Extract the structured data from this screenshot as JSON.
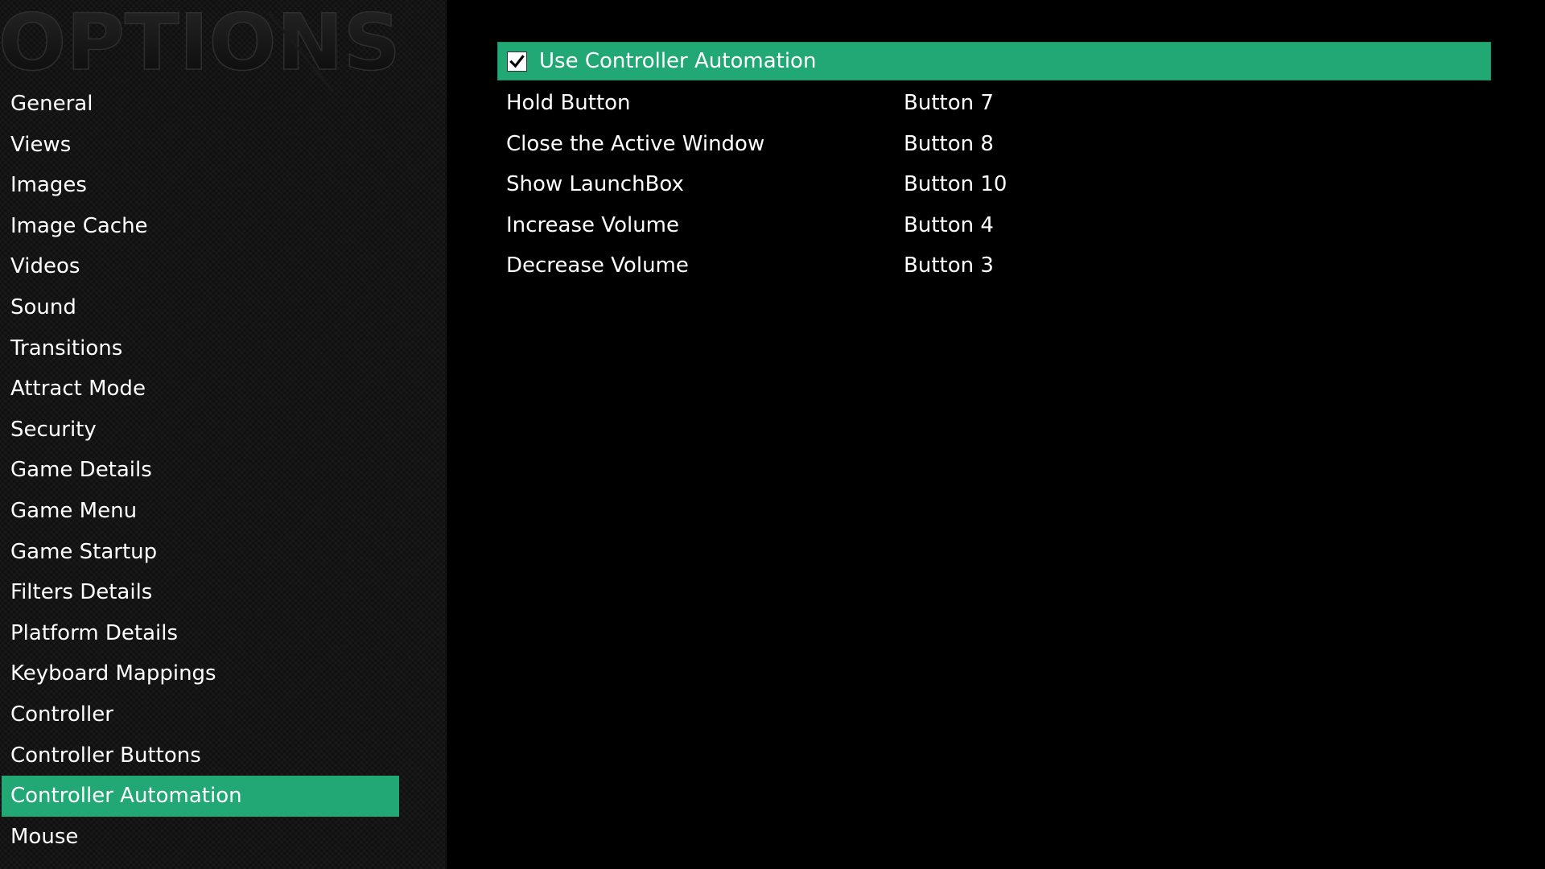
{
  "sidebar": {
    "logo_text": "OPTIONS",
    "items": [
      {
        "label": "General"
      },
      {
        "label": "Views"
      },
      {
        "label": "Images"
      },
      {
        "label": "Image Cache"
      },
      {
        "label": "Videos"
      },
      {
        "label": "Sound"
      },
      {
        "label": "Transitions"
      },
      {
        "label": "Attract Mode"
      },
      {
        "label": "Security"
      },
      {
        "label": "Game Details"
      },
      {
        "label": "Game Menu"
      },
      {
        "label": "Game Startup"
      },
      {
        "label": "Filters Details"
      },
      {
        "label": "Platform Details"
      },
      {
        "label": "Keyboard Mappings"
      },
      {
        "label": "Controller"
      },
      {
        "label": "Controller Buttons"
      },
      {
        "label": "Controller Automation",
        "active": true
      },
      {
        "label": "Mouse"
      }
    ]
  },
  "main": {
    "automation_toggle": {
      "label": "Use Controller Automation",
      "checked": true
    },
    "mappings": [
      {
        "action": "Hold Button",
        "button": "Button 7"
      },
      {
        "action": "Close the Active Window",
        "button": "Button 8"
      },
      {
        "action": "Show LaunchBox",
        "button": "Button 10"
      },
      {
        "action": "Increase Volume",
        "button": "Button 4"
      },
      {
        "action": "Decrease Volume",
        "button": "Button 3"
      }
    ]
  },
  "colors": {
    "accent": "#22a875",
    "background": "#000000",
    "sidebar_background": "#141414",
    "text": "#ffffff"
  }
}
